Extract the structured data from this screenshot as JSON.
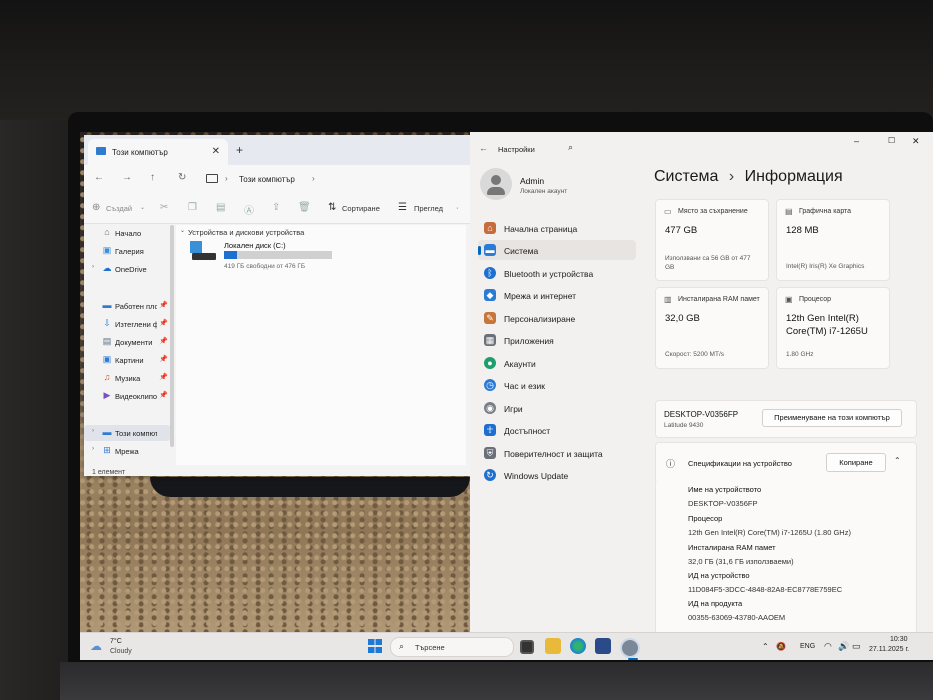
{
  "explorer": {
    "tab_title": "Този компютър",
    "new_tab": "+",
    "close": "✕",
    "address": "Този компютър",
    "toolbar": {
      "new_label": "Създай",
      "sort_label": "Сортиране",
      "view_label": "Преглед"
    },
    "sidebar": [
      {
        "label": "Начало",
        "icon": "home-icon"
      },
      {
        "label": "Галерия",
        "icon": "gallery-icon"
      },
      {
        "label": "OneDrive",
        "icon": "cloud-icon"
      },
      {
        "label": "Работен плот",
        "icon": "desktop-icon",
        "pinned": true
      },
      {
        "label": "Изтеглени файлове",
        "icon": "download-icon",
        "pinned": true
      },
      {
        "label": "Документи",
        "icon": "document-icon",
        "pinned": true
      },
      {
        "label": "Картини",
        "icon": "pictures-icon",
        "pinned": true
      },
      {
        "label": "Музика",
        "icon": "music-icon",
        "pinned": true
      },
      {
        "label": "Видеоклипове",
        "icon": "video-icon",
        "pinned": true
      },
      {
        "label": "Този компютър",
        "icon": "computer-icon"
      },
      {
        "label": "Мрежа",
        "icon": "network-icon"
      }
    ],
    "section_header": "Устройства и дискови устройства",
    "drive": {
      "name": "Локален диск (C:)",
      "free_text": "419 ГБ свободни от 476 ГБ",
      "used_fraction": 0.12
    },
    "status": "1 елемент"
  },
  "settings": {
    "title": "Настройки",
    "user": {
      "name": "Admin",
      "account_type": "Локален акаунт"
    },
    "nav": [
      {
        "label": "Начална страница",
        "icon": "home-icon",
        "color": "#c76b3c"
      },
      {
        "label": "Система",
        "icon": "system-icon",
        "color": "#2b7bd6",
        "selected": true
      },
      {
        "label": "Bluetooth и устройства",
        "icon": "bluetooth-icon",
        "color": "#1e6fd0"
      },
      {
        "label": "Мрежа и интернет",
        "icon": "wifi-icon",
        "color": "#2b7bd6"
      },
      {
        "label": "Персонализиране",
        "icon": "brush-icon",
        "color": "#c8753a"
      },
      {
        "label": "Приложения",
        "icon": "apps-icon",
        "color": "#6a6f78"
      },
      {
        "label": "Акаунти",
        "icon": "accounts-icon",
        "color": "#1f9e6d"
      },
      {
        "label": "Час и език",
        "icon": "clock-globe-icon",
        "color": "#2b7bd6"
      },
      {
        "label": "Игри",
        "icon": "gamepad-icon",
        "color": "#7a7f87"
      },
      {
        "label": "Достъпност",
        "icon": "accessibility-icon",
        "color": "#1e6fd0"
      },
      {
        "label": "Поверителност и защита",
        "icon": "shield-icon",
        "color": "#6a6f78"
      },
      {
        "label": "Windows Update",
        "icon": "update-icon",
        "color": "#1e6fd0"
      }
    ],
    "breadcrumb": {
      "parent": "Система",
      "separator": "›",
      "current": "Информация"
    },
    "cards": {
      "storage": {
        "label": "Място за съхранение",
        "value": "477 GB",
        "sub": "Използвани са 56 GB от 477 GB"
      },
      "gpu": {
        "label": "Графична карта",
        "value": "128 MB",
        "sub": "Intel(R) Iris(R) Xe Graphics"
      },
      "ram": {
        "label": "Инсталирана RAM памет",
        "value": "32,0 GB",
        "sub": "Скорост: 5200 MT/s"
      },
      "cpu": {
        "label": "Процесор",
        "value": "12th Gen Intel(R) Core(TM) i7-1265U",
        "sub": "1.80 GHz"
      }
    },
    "device": {
      "name": "DESKTOP-V0356FP",
      "model": "Latitude 9430",
      "rename_button": "Преименуване на този компютър"
    },
    "specs": {
      "header": "Спецификации на устройство",
      "copy_button": "Копиране",
      "rows": [
        {
          "name": "Име на устройството",
          "value": "DESKTOP-V0356FP"
        },
        {
          "name": "Процесор",
          "value": "12th Gen Intel(R) Core(TM) i7-1265U (1.80 GHz)"
        },
        {
          "name": "Инсталирана RAM памет",
          "value": "32,0 ГБ (31,6 ГБ използваеми)"
        },
        {
          "name": "ИД на устройство",
          "value": "11D084F5-3DCC-4848-82A8-EC8778E759EC"
        },
        {
          "name": "ИД на продукта",
          "value": "00355-63069-43780-AAOEM"
        }
      ]
    }
  },
  "taskbar": {
    "weather": {
      "temp": "7°C",
      "condition": "Cloudy"
    },
    "search_placeholder": "Търсене",
    "language": "ENG",
    "time": "10:30",
    "date": "27.11.2025 г."
  }
}
